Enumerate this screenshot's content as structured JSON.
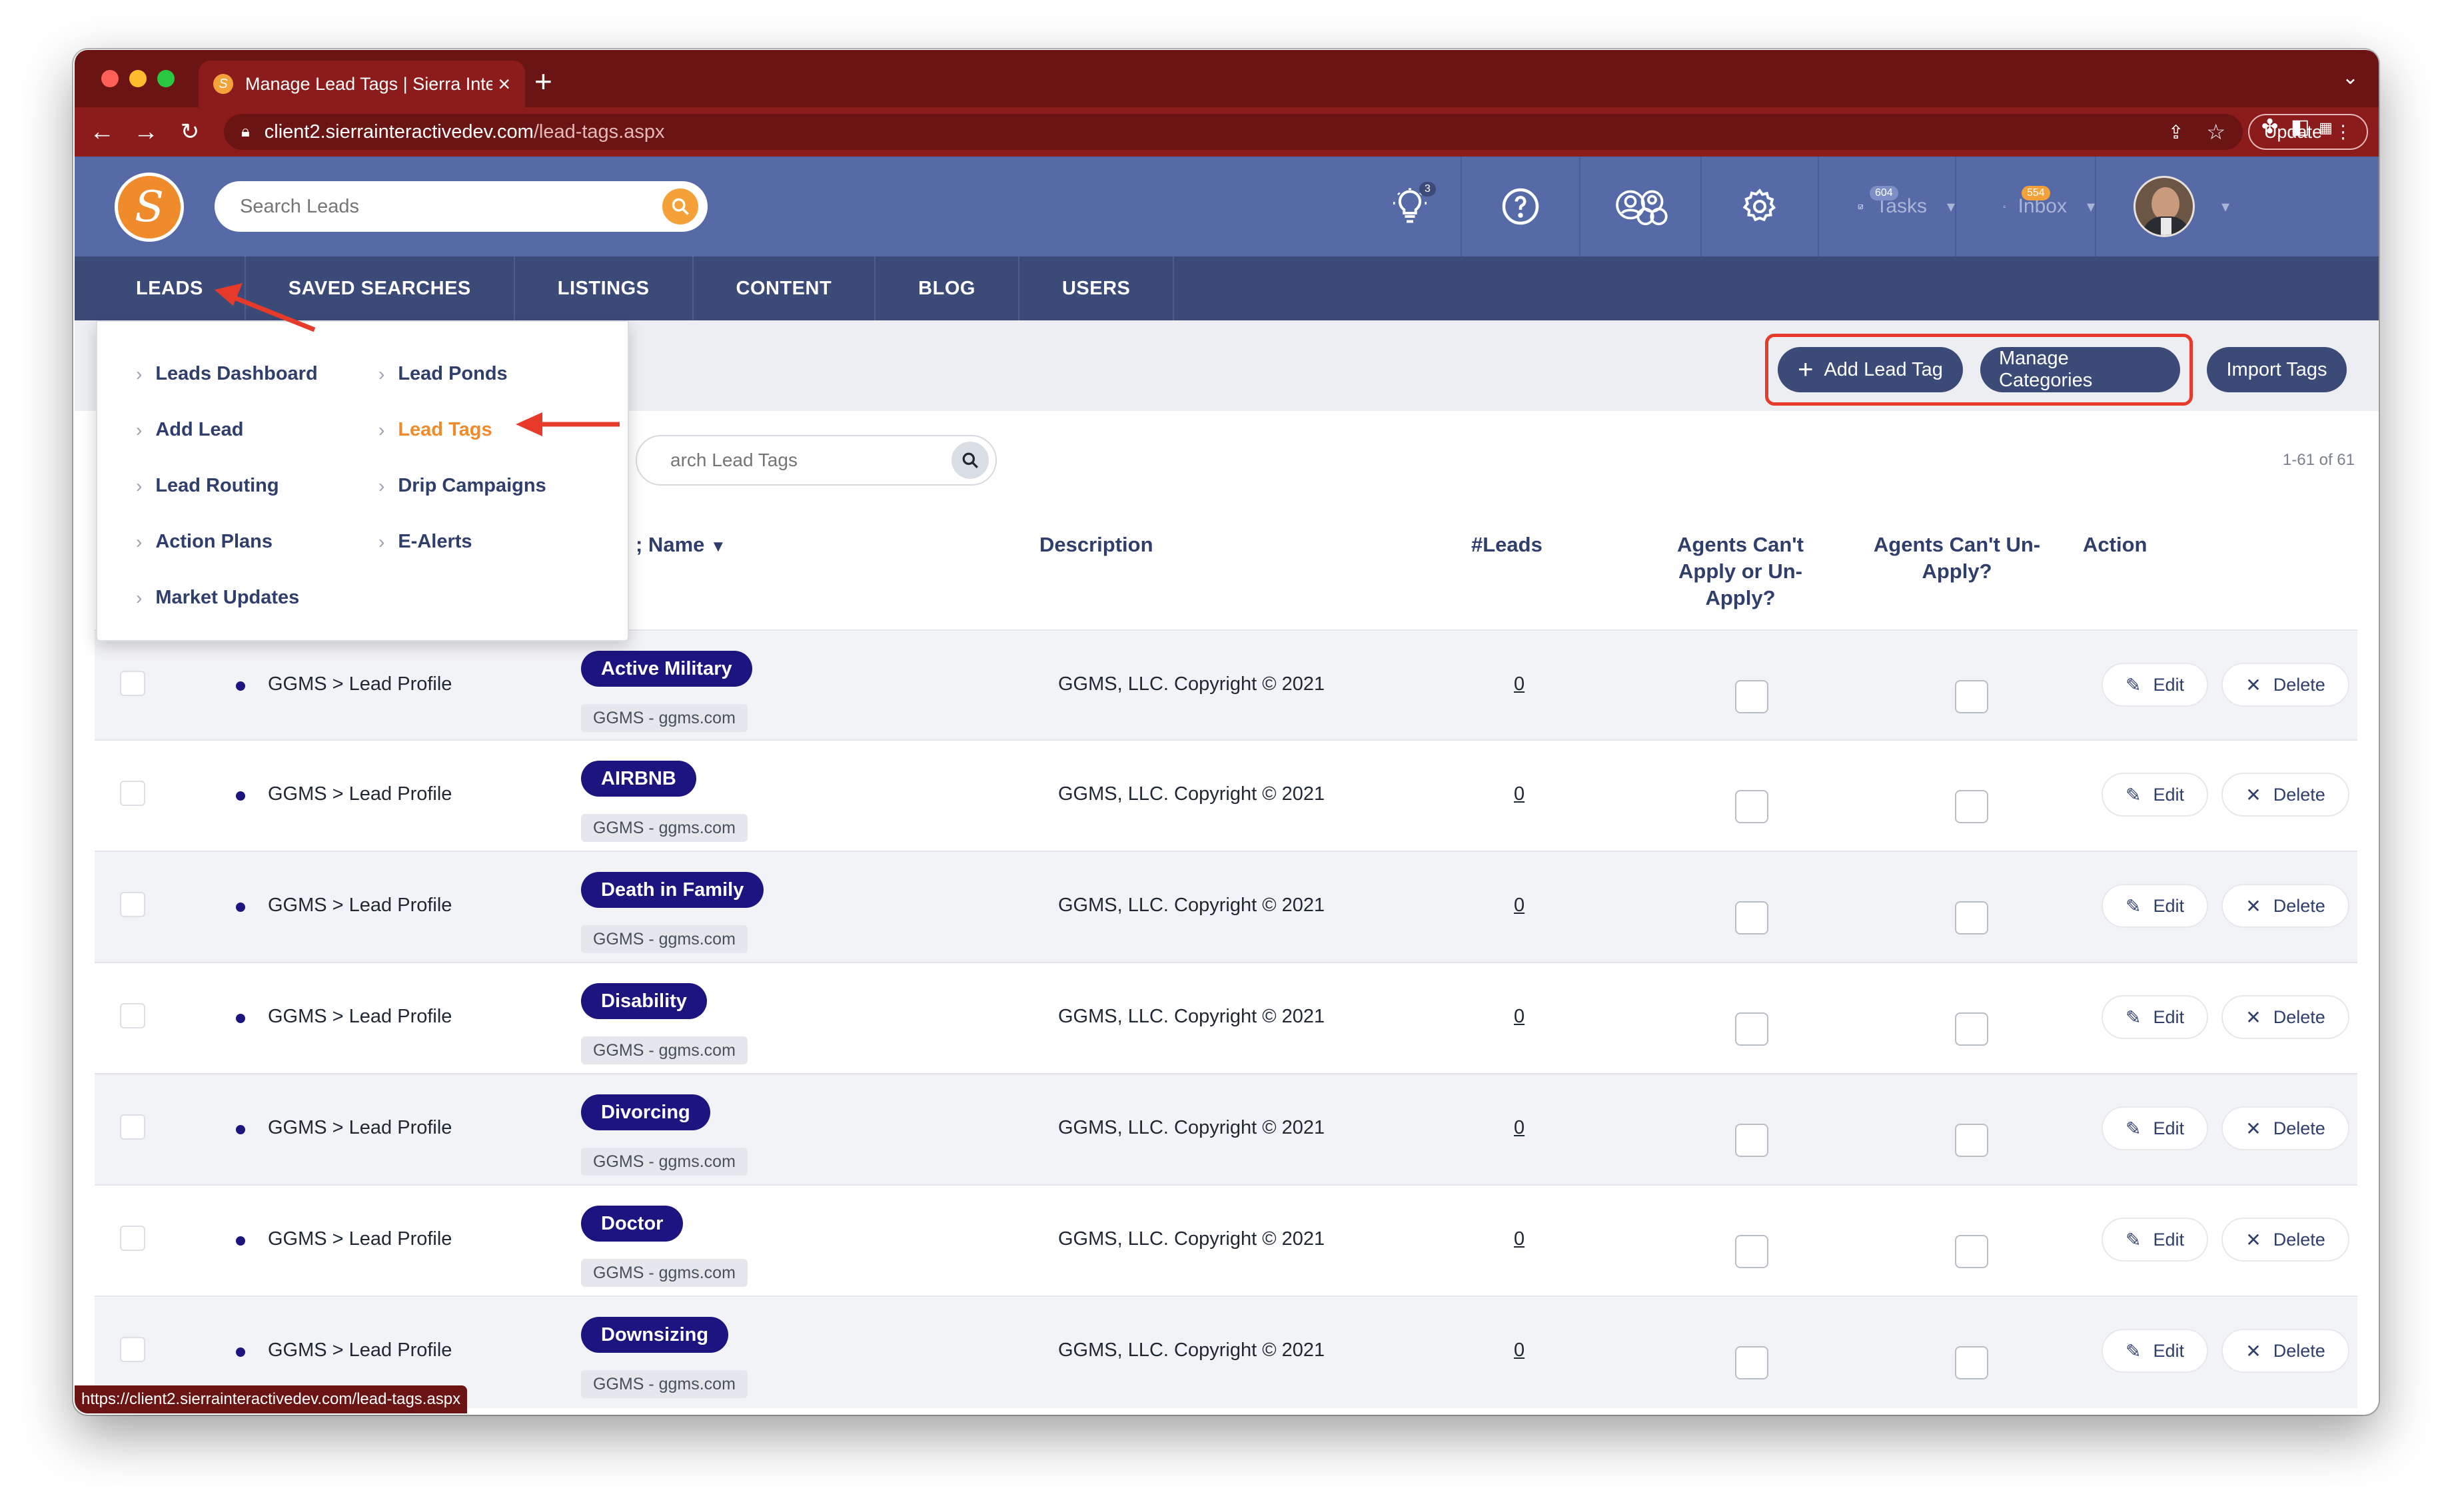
{
  "browser": {
    "tab_title": "Manage Lead Tags | Sierra Inte",
    "url_domain": "client2.sierrainteractivedev.com",
    "url_path": "/lead-tags.aspx",
    "update_label": "Update",
    "status_url": "https://client2.sierrainteractivedev.com/lead-tags.aspx"
  },
  "header": {
    "search_placeholder": "Search Leads",
    "ideas_badge": "3",
    "tasks_label": "Tasks",
    "tasks_badge": "604",
    "inbox_label": "Inbox",
    "inbox_badge": "554"
  },
  "nav": {
    "items": [
      "LEADS",
      "SAVED SEARCHES",
      "LISTINGS",
      "CONTENT",
      "BLOG",
      "USERS"
    ]
  },
  "leads_menu": {
    "col1": [
      "Leads Dashboard",
      "Add Lead",
      "Lead Routing",
      "Action Plans",
      "Market Updates"
    ],
    "col2": [
      "Lead Ponds",
      "Lead Tags",
      "Drip Campaigns",
      "E-Alerts"
    ]
  },
  "actions": {
    "add_lead_tag": "Add Lead Tag",
    "manage_categories": "Manage Categories",
    "import_tags": "Import Tags"
  },
  "table": {
    "search_placeholder": "arch Lead Tags",
    "count": "1-61 of 61",
    "headers": {
      "name": "; Name",
      "description": "Description",
      "leads": "#Leads",
      "cant_apply_1": "Agents Can't",
      "cant_apply_2": "Apply or Un-",
      "cant_apply_3": "Apply?",
      "cant_unapply_1": "Agents Can't Un-",
      "cant_unapply_2": "Apply?",
      "action": "Action"
    },
    "rows": [
      {
        "category": "GGMS > Lead Profile",
        "tag": "Active Military",
        "source": "GGMS - ggms.com",
        "description": "GGMS, LLC. Copyright © 2021",
        "leads": "0"
      },
      {
        "category": "GGMS > Lead Profile",
        "tag": "AIRBNB",
        "source": "GGMS - ggms.com",
        "description": "GGMS, LLC. Copyright © 2021",
        "leads": "0"
      },
      {
        "category": "GGMS > Lead Profile",
        "tag": "Death in Family",
        "source": "GGMS - ggms.com",
        "description": "GGMS, LLC. Copyright © 2021",
        "leads": "0"
      },
      {
        "category": "GGMS > Lead Profile",
        "tag": "Disability",
        "source": "GGMS - ggms.com",
        "description": "GGMS, LLC. Copyright © 2021",
        "leads": "0"
      },
      {
        "category": "GGMS > Lead Profile",
        "tag": "Divorcing",
        "source": "GGMS - ggms.com",
        "description": "GGMS, LLC. Copyright © 2021",
        "leads": "0"
      },
      {
        "category": "GGMS > Lead Profile",
        "tag": "Doctor",
        "source": "GGMS - ggms.com",
        "description": "GGMS, LLC. Copyright © 2021",
        "leads": "0"
      },
      {
        "category": "GGMS > Lead Profile",
        "tag": "Downsizing",
        "source": "GGMS - ggms.com",
        "description": "GGMS, LLC. Copyright © 2021",
        "leads": "0"
      }
    ],
    "edit_label": "Edit",
    "delete_label": "Delete"
  },
  "colors": {
    "chrome": "#8c1c1c",
    "header": "#566aa8",
    "nav": "#3c4a78",
    "tag": "#1c1580",
    "accent": "#f08b2c",
    "annotation": "#e63a2a"
  },
  "icons": [
    "search-icon",
    "lightbulb-icon",
    "help-icon",
    "users-icon",
    "gear-icon",
    "tasks-icon",
    "bell-icon",
    "edit-icon",
    "delete-icon",
    "chevron-right-icon",
    "sort-down-icon"
  ]
}
